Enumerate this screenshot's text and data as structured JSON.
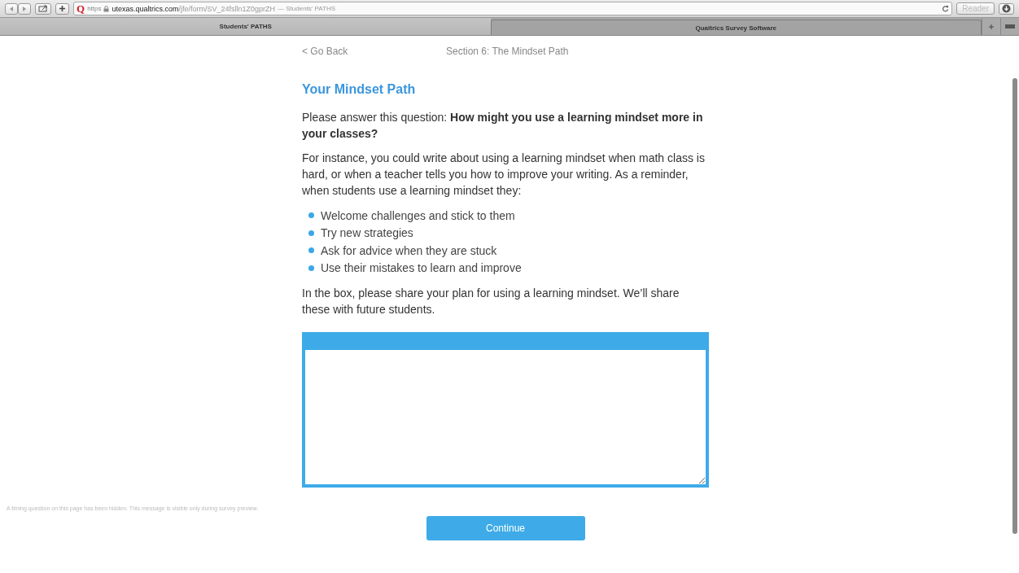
{
  "browser": {
    "toolbar": {
      "site_icon": "Q",
      "scheme": "https",
      "domain": "utexas.qualtrics.com",
      "path": "/jfe/form/SV_24fslln1Z0gprZH",
      "page_title": "— Students' PATHS",
      "reader_button": "Reader"
    },
    "tabs": [
      {
        "label": "Students' PATHS",
        "selected": true
      },
      {
        "label": "Qualtrics Survey Software",
        "selected": false
      }
    ]
  },
  "survey": {
    "back_link": "< Go Back",
    "section": "Section 6: The Mindset Path",
    "heading": "Your Mindset Path",
    "question": "Please answer this question: **How might you use a learning mindset more in your classes?**",
    "instructions": "For instance, you could write about using a learning mindset when math class is hard, or when a teacher tells you how to improve your writing. As a reminder, when students use a learning mindset they:",
    "bullets": [
      "Welcome challenges and stick to them",
      "Try new strategies",
      "Ask for advice when they are stuck",
      "Use their mistakes to learn and improve"
    ],
    "prompt": "In the box, please share your plan for using a learning mindset. We’ll share these with future students.",
    "timing_note": "A timing question on this page has been hidden. This message is visible only during survey preview.",
    "continue_button": "Continue"
  }
}
